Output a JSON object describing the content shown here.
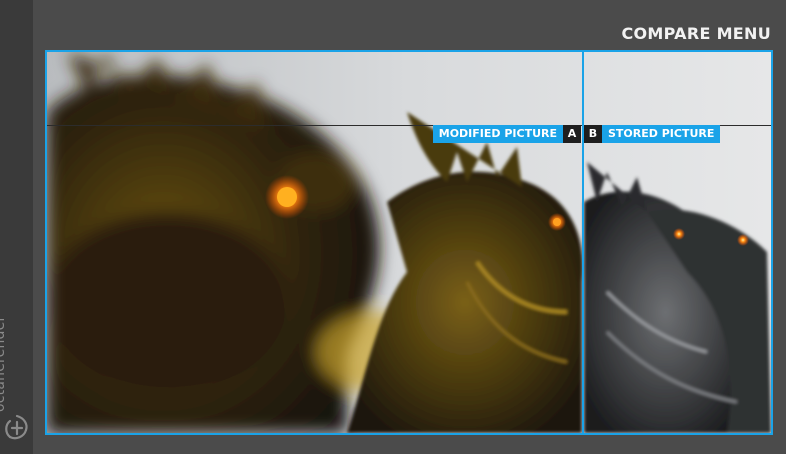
{
  "header": {
    "title": "COMPARE MENU"
  },
  "brand": {
    "name": "octanerender",
    "trademark": "™",
    "logo_icon": "octane-logo-icon"
  },
  "compare": {
    "modified": {
      "label": "MODIFIED PICTURE",
      "letter": "A"
    },
    "stored": {
      "label": "STORED PICTURE",
      "letter": "B"
    }
  },
  "colors": {
    "accent": "#1aa3e8",
    "background": "#4b4b4b",
    "sidebar": "#3a3a3a"
  }
}
